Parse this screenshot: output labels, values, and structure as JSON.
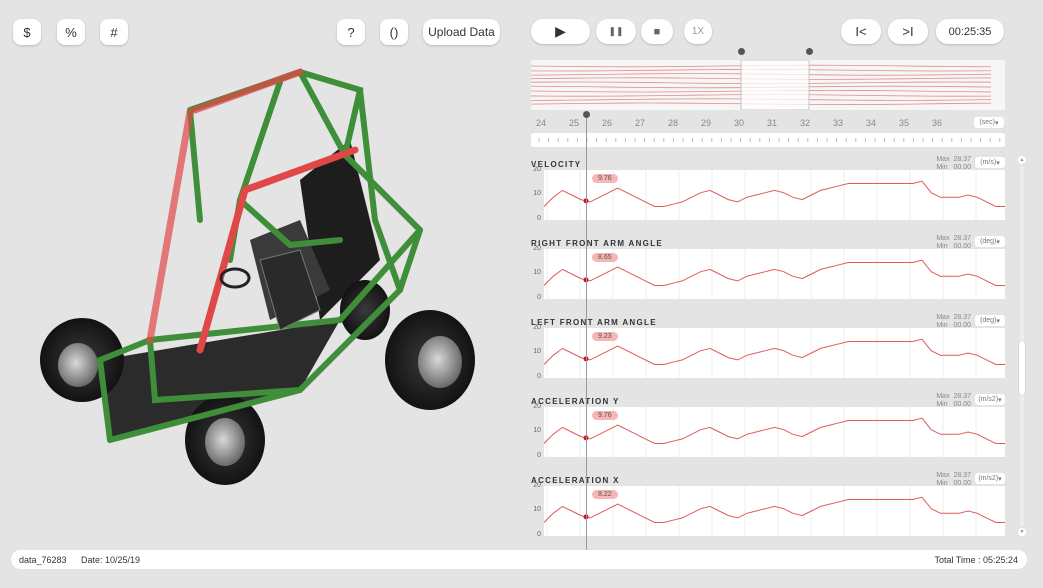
{
  "toolbar_left": {
    "dollar": "$",
    "percent": "%",
    "hash": "#",
    "help": "?",
    "parens": "()",
    "upload": "Upload Data"
  },
  "playback": {
    "play": "▶",
    "pause": "❚❚",
    "stop": "■",
    "speed": "1X",
    "skip_start": "I<",
    "skip_end": ">I",
    "time": "00:25:35"
  },
  "timeline": {
    "ticks": [
      "24",
      "25",
      "26",
      "27",
      "28",
      "29",
      "30",
      "31",
      "32",
      "33",
      "34",
      "35",
      "36"
    ],
    "unit": "(sec)"
  },
  "charts": [
    {
      "title": "VELOCITY",
      "max_label": "Max",
      "max": "28.37",
      "min_label": "Min",
      "min": "00.00",
      "unit": "(m/s)",
      "value": "9.76",
      "yticks": [
        "20",
        "10",
        "0"
      ]
    },
    {
      "title": "RIGHT FRONT ARM ANGLE",
      "max_label": "Max",
      "max": "28.37",
      "min_label": "Min",
      "min": "00.00",
      "unit": "(deg)",
      "value": "8.65",
      "yticks": [
        "20",
        "10",
        "0"
      ]
    },
    {
      "title": "LEFT FRONT ARM ANGLE",
      "max_label": "Max",
      "max": "28.37",
      "min_label": "Min",
      "min": "00.00",
      "unit": "(deg)",
      "value": "9.23",
      "yticks": [
        "20",
        "10",
        "0"
      ]
    },
    {
      "title": "ACCELERATION Y",
      "max_label": "Max",
      "max": "28.37",
      "min_label": "Min",
      "min": "00.00",
      "unit": "(m/s2)",
      "value": "9.76",
      "yticks": [
        "20",
        "10",
        "0"
      ]
    },
    {
      "title": "ACCELERATION X",
      "max_label": "Max",
      "max": "28.37",
      "min_label": "Min",
      "min": "00.00",
      "unit": "(m/s2)",
      "value": "8.22",
      "yticks": [
        "20",
        "10",
        "0"
      ]
    }
  ],
  "series": [
    [
      5,
      9,
      12,
      10,
      8,
      7,
      9,
      11,
      13,
      11,
      9,
      7,
      5,
      5,
      6,
      7,
      9,
      11,
      12,
      10,
      8,
      7,
      9,
      10,
      11,
      12,
      11,
      9,
      8,
      10,
      12,
      13,
      14,
      15,
      15,
      15,
      15,
      15,
      15,
      15,
      15,
      16,
      11,
      9,
      9,
      9,
      10,
      9,
      7,
      5,
      5
    ],
    [
      5,
      9,
      12,
      10,
      8,
      7,
      9,
      11,
      13,
      11,
      9,
      7,
      5,
      5,
      6,
      7,
      9,
      11,
      12,
      10,
      8,
      7,
      9,
      10,
      11,
      12,
      11,
      9,
      8,
      10,
      12,
      13,
      14,
      15,
      15,
      15,
      15,
      15,
      15,
      15,
      15,
      16,
      11,
      9,
      9,
      9,
      10,
      9,
      7,
      5,
      5
    ],
    [
      5,
      9,
      12,
      10,
      8,
      7,
      9,
      11,
      13,
      11,
      9,
      7,
      5,
      5,
      6,
      7,
      9,
      11,
      12,
      10,
      8,
      7,
      9,
      10,
      11,
      12,
      11,
      9,
      8,
      10,
      12,
      13,
      14,
      15,
      15,
      15,
      15,
      15,
      15,
      15,
      15,
      16,
      11,
      9,
      9,
      9,
      10,
      9,
      7,
      5,
      5
    ],
    [
      5,
      9,
      12,
      10,
      8,
      7,
      9,
      11,
      13,
      11,
      9,
      7,
      5,
      5,
      6,
      7,
      9,
      11,
      12,
      10,
      8,
      7,
      9,
      10,
      11,
      12,
      11,
      9,
      8,
      10,
      12,
      13,
      14,
      15,
      15,
      15,
      15,
      15,
      15,
      15,
      15,
      16,
      11,
      9,
      9,
      9,
      10,
      9,
      7,
      5,
      5
    ],
    [
      5,
      9,
      12,
      10,
      8,
      7,
      9,
      11,
      13,
      11,
      9,
      7,
      5,
      5,
      6,
      7,
      9,
      11,
      12,
      10,
      8,
      7,
      9,
      10,
      11,
      12,
      11,
      9,
      8,
      10,
      12,
      13,
      14,
      15,
      15,
      15,
      15,
      15,
      15,
      15,
      15,
      16,
      11,
      9,
      9,
      9,
      10,
      9,
      7,
      5,
      5
    ]
  ],
  "footer": {
    "file": "data_76283",
    "date": "Date: 10/25/19",
    "total": "Total Time : 05:25:24"
  },
  "colors": {
    "accent": "#e05a5a",
    "frame_green": "#3f8f3a",
    "frame_red": "#e04848"
  },
  "icons": [
    "play-icon",
    "pause-icon",
    "stop-icon",
    "skip-start-icon",
    "skip-end-icon",
    "chevron-down-icon",
    "scroll-up-icon",
    "scroll-down-icon"
  ]
}
